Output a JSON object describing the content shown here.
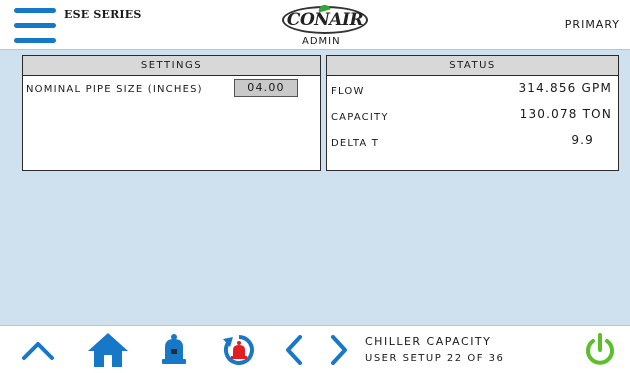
{
  "header": {
    "series": "ESE SERIES",
    "logo": "CONAIR",
    "user_level": "ADMIN",
    "mode": "PRIMARY"
  },
  "settings": {
    "title": "SETTINGS",
    "items": [
      {
        "label": "NOMINAL PIPE SIZE (INCHES)",
        "value": "04.00"
      }
    ]
  },
  "status": {
    "title": "STATUS",
    "items": [
      {
        "label": "FLOW",
        "value": "314.856 GPM"
      },
      {
        "label": "CAPACITY",
        "value": "130.078 TON"
      },
      {
        "label": "DELTA T",
        "value": "9.9"
      }
    ]
  },
  "footer": {
    "screen_name": "CHILLER CAPACITY",
    "screen_page": "USER SETUP 22 OF 36",
    "icons": {
      "up": "chevron-up-icon",
      "home": "home-icon",
      "alarm": "bell-icon",
      "alarm_history": "alarm-history-icon",
      "prev": "chevron-left-icon",
      "next": "chevron-right-icon",
      "power": "power-icon"
    }
  },
  "colors": {
    "accent": "#1878c8",
    "background": "#cfe0ee",
    "alarm": "#e02020",
    "power": "#5bbf2a",
    "logo_dot": "#2fa836"
  }
}
